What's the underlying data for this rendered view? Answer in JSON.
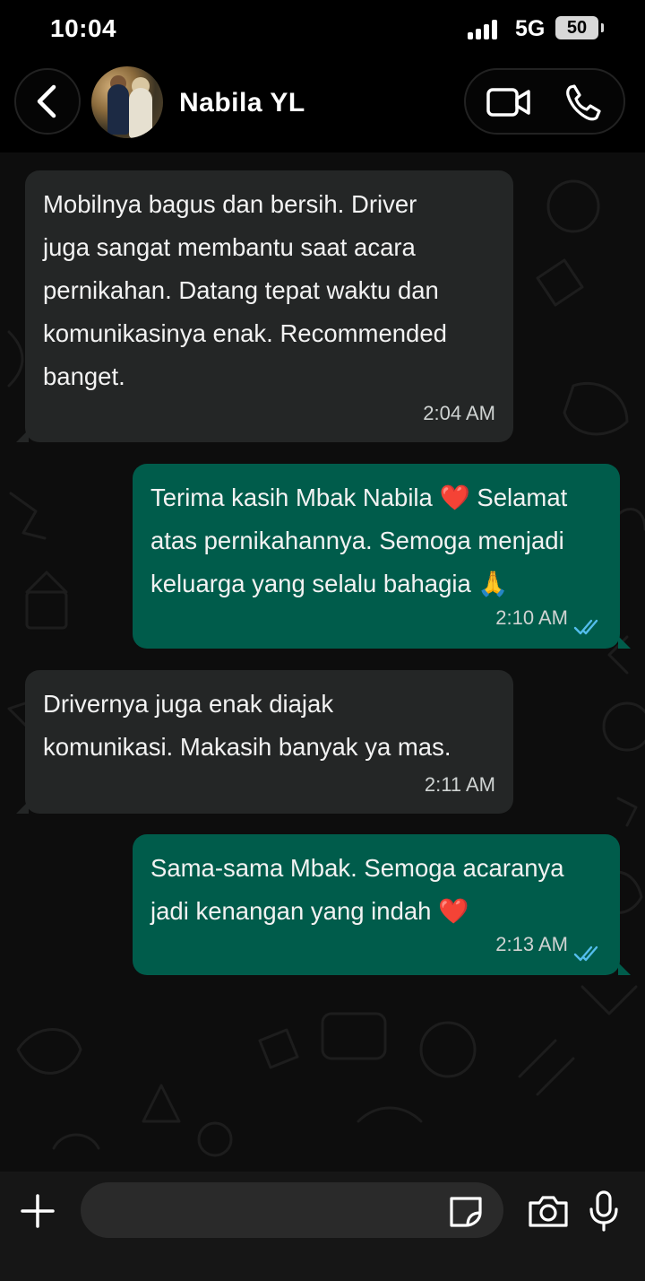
{
  "status_bar": {
    "time": "10:04",
    "network": "5G",
    "battery": "50"
  },
  "header": {
    "contact_name": "Nabila YL",
    "icons": [
      "back-arrow-icon",
      "video-call-icon",
      "phone-call-icon"
    ]
  },
  "messages": [
    {
      "direction": "incoming",
      "text": "Mobilnya bagus dan bersih. Driver\njuga sangat membantu saat acara\npernikahan. Datang tepat waktu dan\nkomunikasinya enak. Recommended\nbanget.",
      "time": "2:04 AM"
    },
    {
      "direction": "outgoing",
      "text_line1": "Terima kasih Mbak Nabila",
      "emoji_heart": "❤️",
      "text_line1b": " Selamat",
      "text_line2": "atas pernikahannya. Semoga menjadi",
      "text_line3": "keluarga yang selalu bahagia ",
      "emoji_pray": "🙏",
      "time": "2:10 AM",
      "status": "read"
    },
    {
      "direction": "incoming",
      "text": "Drivernya juga enak diajak\nkomunikasi. Makasih banyak ya mas.",
      "time": "2:11 AM"
    },
    {
      "direction": "outgoing",
      "text_line1": "Sama-sama Mbak. Semoga acaranya",
      "text_line2": "jadi kenangan yang indah ",
      "emoji_heart": "❤️",
      "time": "2:13 AM",
      "status": "read"
    }
  ],
  "input_bar": {
    "placeholder": "",
    "icons": [
      "plus-icon",
      "sticker-icon",
      "camera-icon",
      "microphone-icon"
    ]
  },
  "colors": {
    "incoming_bubble": "#242626",
    "outgoing_bubble": "#005c4b",
    "read_ticks": "#53bdeb",
    "background": "#0d0d0d"
  }
}
